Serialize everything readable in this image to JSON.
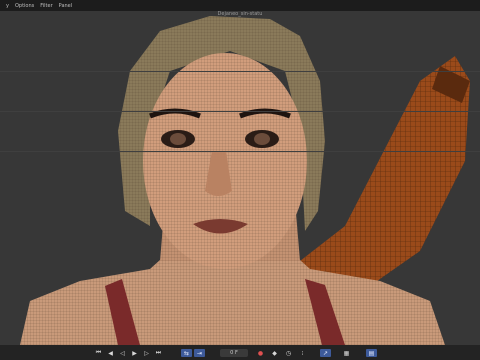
{
  "menu": {
    "items": [
      "y",
      "Options",
      "Filter",
      "Panel"
    ],
    "title": "Dejaneo_sin-statu"
  },
  "timeline": {
    "frame": "0 F"
  },
  "icons": [
    "skip-start-icon",
    "step-back-icon",
    "play-reverse-icon",
    "play-icon",
    "step-forward-icon",
    "skip-end-icon",
    "loop-icon",
    "range-icon",
    "record-icon",
    "keyframe-icon",
    "timer-icon",
    "options-icon",
    "motion-icon",
    "grid-icon",
    "layout-icon"
  ],
  "colors": {
    "menubar": "#1c1c1c",
    "viewport": "#373737",
    "accent": "#3d5a9a",
    "record": "#e05050"
  }
}
